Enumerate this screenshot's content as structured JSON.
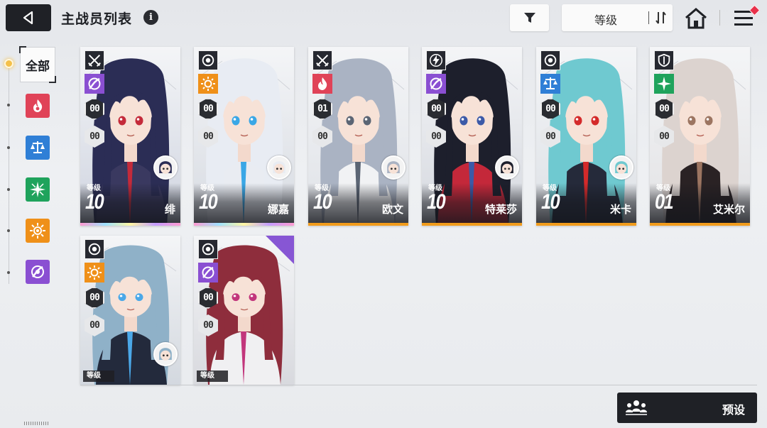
{
  "header": {
    "title": "主战员列表",
    "info_icon": "i",
    "filter_icon": "filter-icon",
    "sort": {
      "label": "等级",
      "icon": "sort-order-icon"
    },
    "home_icon": "home-icon",
    "menu_icon": "menu-icon"
  },
  "sidebar": {
    "all_label": "全部",
    "categories": [
      {
        "name": "fire",
        "color": "#e04358"
      },
      {
        "name": "balance",
        "color": "#2f7fd6"
      },
      {
        "name": "wind",
        "color": "#1fa35c"
      },
      {
        "name": "sun",
        "color": "#ef9019"
      },
      {
        "name": "void",
        "color": "#8a4fd2"
      }
    ]
  },
  "level_label": "等级",
  "cards": [
    {
      "name": "绯",
      "level": "10",
      "class_icon": "crossed-swords-icon",
      "element": "void",
      "element_color": "#8a4fd2",
      "stat1": "00",
      "stat2": "00",
      "rarity": "ssr",
      "hair": "#2b2d55",
      "outfit": "#3a3960",
      "accent": "#c42a3a",
      "bg": "#cfd4e0"
    },
    {
      "name": "娜嘉",
      "level": "10",
      "class_icon": "target-icon",
      "element": "sun",
      "element_color": "#ef9019",
      "stat1": "00",
      "stat2": "00",
      "rarity": "ssr",
      "hair": "#e8ecf3",
      "outfit": "#e9ecf2",
      "accent": "#3aa7e6",
      "bg": "#d7dbe2"
    },
    {
      "name": "欧文",
      "level": "10",
      "class_icon": "crossed-swords-icon",
      "element": "fire",
      "element_color": "#e04358",
      "stat1": "01",
      "stat2": "00",
      "rarity": "sr",
      "hair": "#aab3c3",
      "outfit": "#f1f2f4",
      "accent": "#5b6574",
      "bg": "#dfe2e7"
    },
    {
      "name": "特莱莎",
      "level": "10",
      "class_icon": "lightning-icon",
      "element": "void",
      "element_color": "#8a4fd2",
      "stat1": "00",
      "stat2": "00",
      "rarity": "sr",
      "hair": "#1d1f2c",
      "outfit": "#c4283a",
      "accent": "#3c5aa8",
      "bg": "#d5d8df"
    },
    {
      "name": "米卡",
      "level": "10",
      "class_icon": "target-icon",
      "element": "balance",
      "element_color": "#2f7fd6",
      "stat1": "00",
      "stat2": "00",
      "rarity": "sr",
      "hair": "#6fc9d0",
      "outfit": "#252a3a",
      "accent": "#d42a2a",
      "bg": "#dde1e6"
    },
    {
      "name": "艾米尔",
      "level": "01",
      "class_icon": "shield-icon",
      "element": "wind",
      "element_color": "#1fa35c",
      "stat1": "00",
      "stat2": "00",
      "rarity": "sr",
      "hair": "#dcd3cf",
      "outfit": "#2a2224",
      "accent": "#9c7561",
      "bg": "#e2e2e4"
    },
    {
      "name": "",
      "level": "",
      "class_icon": "target-icon",
      "element": "sun",
      "element_color": "#ef9019",
      "stat1": "00",
      "stat2": "00",
      "rarity": "none",
      "hair": "#8fb1c8",
      "outfit": "#232a3c",
      "accent": "#4ba8e8",
      "bg": "#d3d8df"
    },
    {
      "name": "",
      "level": "",
      "class_icon": "target-icon",
      "element": "void",
      "element_color": "#8a4fd2",
      "stat1": "00",
      "stat2": "00",
      "rarity": "none",
      "hair": "#8e2d3c",
      "outfit": "#f0f0f2",
      "accent": "#c2367c",
      "bg": "#d8d9de"
    }
  ],
  "preset": {
    "label": "预设",
    "icon": "team-preset-icon"
  }
}
